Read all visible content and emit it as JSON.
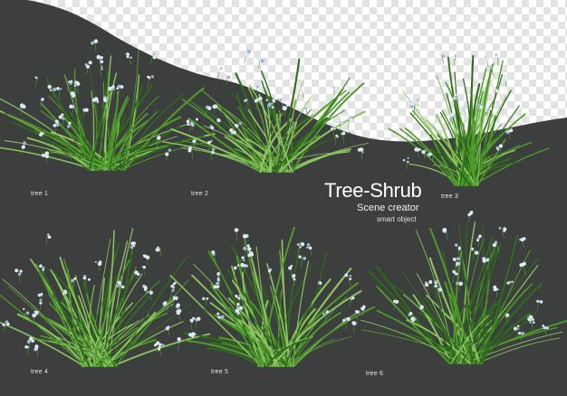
{
  "heading": {
    "title": "Tree-Shrub",
    "subtitle": "Scene creator",
    "caption": "smart object"
  },
  "shrubs": [
    {
      "label": "tree 1"
    },
    {
      "label": "tree 2"
    },
    {
      "label": "tree 3"
    },
    {
      "label": "tree 4"
    },
    {
      "label": "tree 5"
    },
    {
      "label": "tree 6"
    }
  ],
  "colors": {
    "background": "#3d3e3e",
    "transparency_light": "#ffffff",
    "transparency_dark": "#e3e3e3",
    "grass_dark": "#2f6b1c",
    "grass_mid": "#4f9a2c",
    "grass_light": "#8cc460",
    "flower": "#dfe8f3",
    "flower_center": "#9fb6d2"
  }
}
